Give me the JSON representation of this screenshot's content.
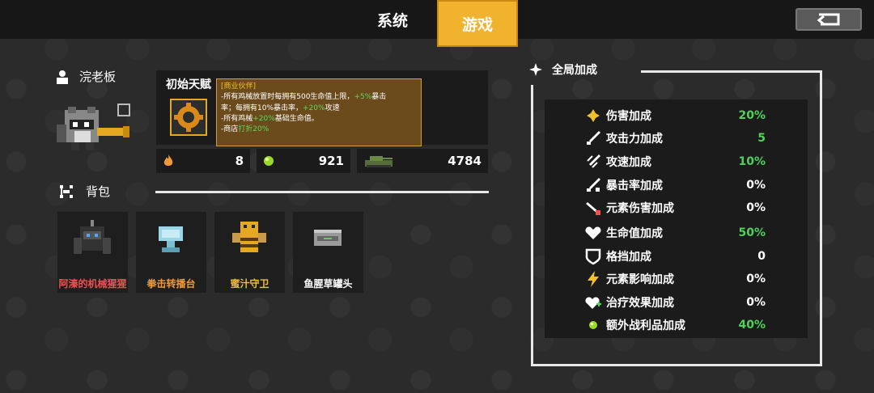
{
  "tabs": [
    {
      "label": "系统"
    },
    {
      "label": "游戏"
    }
  ],
  "profile": {
    "name": "浣老板"
  },
  "talent": {
    "title": "初始天赋",
    "tooltip": {
      "header": "[商业伙伴]",
      "line1a": "-所有鸡械放置时每拥有500生命值上限，",
      "line1b": "+5%",
      "line1c": "暴击",
      "line2a": "率；每拥有10%暴击率，",
      "line2b": "+20%",
      "line2c": "攻速",
      "line3a": "-所有鸡械",
      "line3b": "+20%",
      "line3c": "基础生命值。",
      "line4a": "-商店",
      "line4b": "打折20%"
    }
  },
  "stats": [
    {
      "icon": "fire-icon",
      "value": "8"
    },
    {
      "icon": "green-orb-icon",
      "value": "921"
    },
    {
      "icon": "tank-icon",
      "value": "4784"
    }
  ],
  "bag": {
    "title": "背包",
    "items": [
      {
        "name": "阿溱的机械猩猩",
        "color": "#f05050"
      },
      {
        "name": "拳击转播台",
        "color": "#f29a3a"
      },
      {
        "name": "蜜汁守卫",
        "color": "#f1c02a"
      },
      {
        "name": "鱼腥草罐头",
        "color": "#ffffff"
      }
    ]
  },
  "global": {
    "title": "全局加成",
    "bonuses": [
      {
        "label": "伤害加成",
        "value": "20%",
        "green": true,
        "icon": "damage-icon"
      },
      {
        "label": "攻击力加成",
        "value": "5",
        "green": true,
        "icon": "sword-icon"
      },
      {
        "label": "攻速加成",
        "value": "10%",
        "green": true,
        "icon": "attack-speed-icon"
      },
      {
        "label": "暴击率加成",
        "value": "0%",
        "green": false,
        "icon": "crit-icon"
      },
      {
        "label": "元素伤害加成",
        "value": "0%",
        "green": false,
        "icon": "element-damage-icon"
      },
      {
        "label": "生命值加成",
        "value": "50%",
        "green": true,
        "icon": "heart-icon"
      },
      {
        "label": "格挡加成",
        "value": "0",
        "green": false,
        "icon": "shield-icon"
      },
      {
        "label": "元素影响加成",
        "value": "0%",
        "green": false,
        "icon": "lightning-icon"
      },
      {
        "label": "治疗效果加成",
        "value": "0%",
        "green": false,
        "icon": "heal-heart-icon"
      },
      {
        "label": "额外战利品加成",
        "value": "40%",
        "green": true,
        "icon": "loot-orb-icon"
      }
    ]
  }
}
